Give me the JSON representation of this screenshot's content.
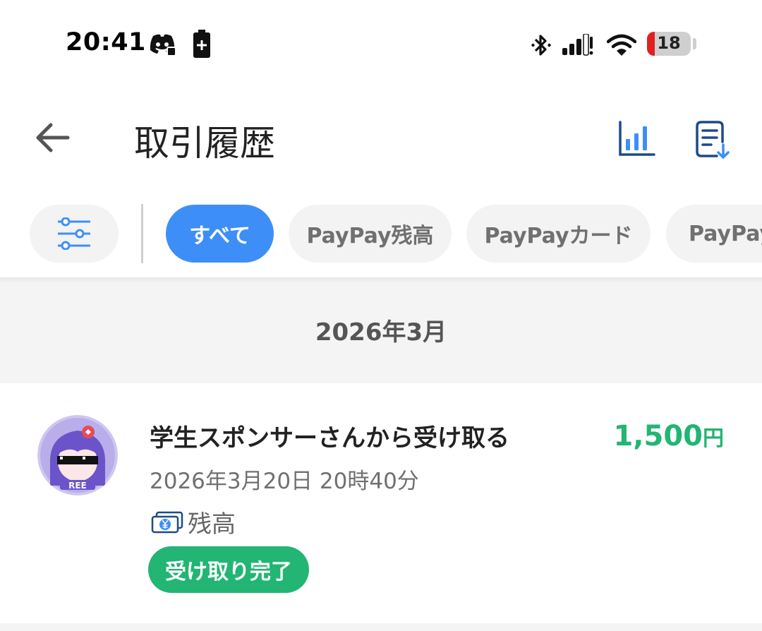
{
  "status_bar": {
    "time": "20:41",
    "battery_level": "18",
    "battery_fraction": 0.18,
    "icons": [
      "discord-icon",
      "battery-saver-icon",
      "bluetooth-icon",
      "signal-icon",
      "wifi-icon",
      "battery-icon"
    ]
  },
  "header": {
    "title": "取引履歴",
    "icons": [
      "back-arrow-icon",
      "bar-chart-icon",
      "document-download-icon"
    ]
  },
  "filters": {
    "settings_icon": "sliders-icon",
    "chips": [
      {
        "label": "すべて",
        "active": true
      },
      {
        "label": "PayPay残高",
        "active": false
      },
      {
        "label": "PayPayカード",
        "active": false
      },
      {
        "label": "PayPay",
        "active": false
      }
    ]
  },
  "month_header": "2026年3月",
  "transactions": [
    {
      "title": "学生スポンサーさんから受け取る",
      "amount": "1,500",
      "currency": "円",
      "datetime": "2026年3月20日 20時40分",
      "method": "残高",
      "method_icon": "yen-wallet-icon",
      "status": "受け取り完了",
      "avatar_text": "REE"
    }
  ],
  "colors": {
    "accent_blue": "#3d8ff7",
    "icon_navy": "#1e4a8a",
    "success_green": "#22b573",
    "battery_red": "#e0211f"
  }
}
